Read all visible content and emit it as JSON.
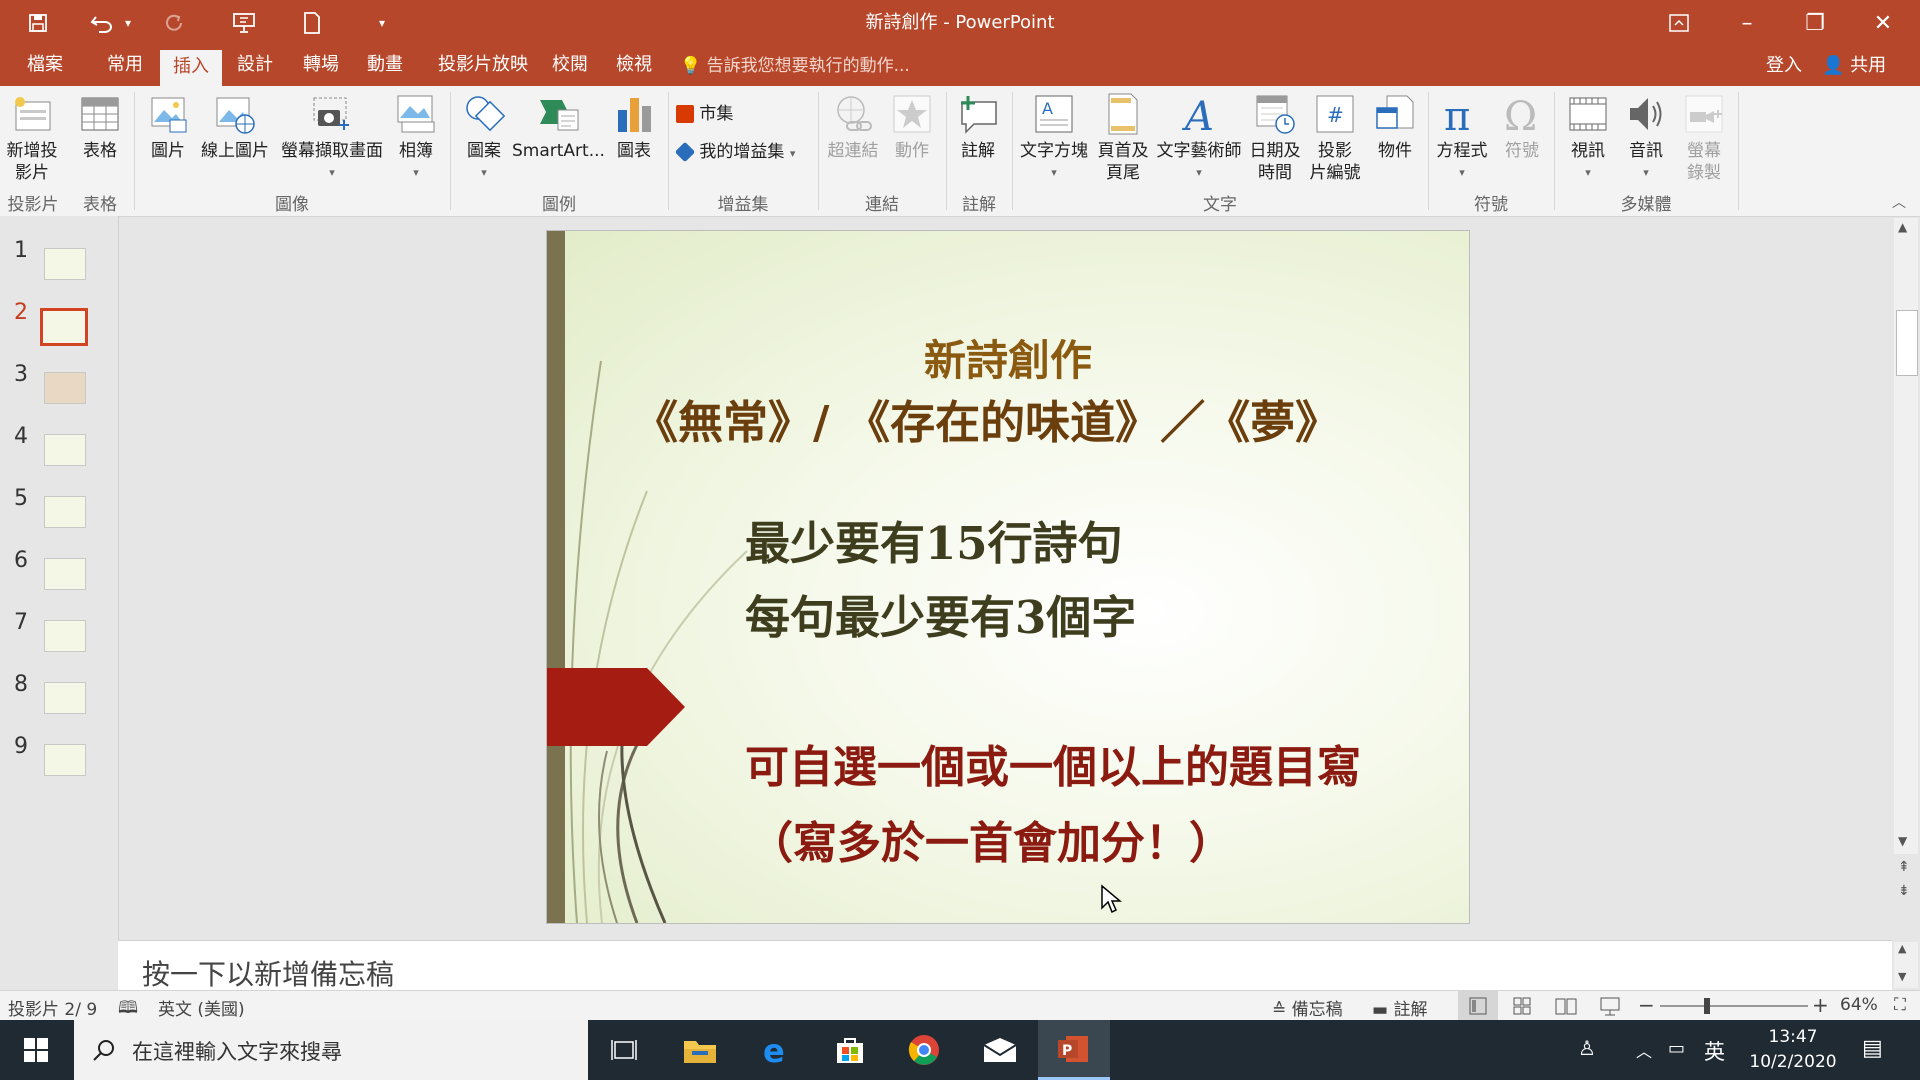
{
  "window": {
    "title": "新詩創作 - PowerPoint",
    "controls": {
      "minimize": "–",
      "restore": "❐",
      "close": "✕"
    }
  },
  "quick_access": {
    "save_icon": "save-icon",
    "undo_icon": "undo-icon",
    "redo_icon": "redo-icon",
    "present_icon": "present-from-start-icon",
    "new_icon": "new-file-icon",
    "customize": "▾"
  },
  "tabs": [
    {
      "label": "檔案"
    },
    {
      "label": "常用"
    },
    {
      "label": "插入"
    },
    {
      "label": "設計"
    },
    {
      "label": "轉場"
    },
    {
      "label": "動畫"
    },
    {
      "label": "投影片放映"
    },
    {
      "label": "校閱"
    },
    {
      "label": "檢視"
    }
  ],
  "active_tab": "插入",
  "tell_me": "告訴我您想要執行的動作...",
  "signin": "登入",
  "share": "共用",
  "ribbon": {
    "new_slide": "新增投\n影片",
    "table": "表格",
    "picture": "圖片",
    "online_picture": "線上圖片",
    "screenshot": "螢幕擷取畫面",
    "album": "相簿",
    "shapes": "圖案",
    "smartart": "SmartArt...",
    "chart": "圖表",
    "store": "市集",
    "my_addins": "我的增益集",
    "hyperlink": "超連結",
    "action": "動作",
    "comment": "註解",
    "textbox": "文字方塊",
    "header_footer": "頁首及\n頁尾",
    "wordart": "文字藝術師",
    "datetime": "日期及\n時間",
    "slide_number": "投影\n片編號",
    "object": "物件",
    "equation": "方程式",
    "symbol": "符號",
    "video": "視訊",
    "audio": "音訊",
    "screen_recording": "螢幕\n錄製",
    "groups": {
      "slides": "投影片",
      "tables": "表格",
      "images": "圖像",
      "illustrations": "圖例",
      "addins": "增益集",
      "links": "連結",
      "comments": "註解",
      "text": "文字",
      "symbols": "符號",
      "media": "多媒體"
    }
  },
  "thumbnails": [
    "1",
    "2",
    "3",
    "4",
    "5",
    "6",
    "7",
    "8",
    "9"
  ],
  "selected_slide": 2,
  "slide": {
    "title_line1": "新詩創作",
    "title_line2": "《無常》/ 《存在的味道》／《夢》",
    "body_line1": "最少要有15行詩句",
    "body_line2": "每句最少要有3個字",
    "note_line1": "可自選一個或一個以上的題目寫",
    "note_line2": "（寫多於一首會加分！）",
    "colors": {
      "title": "#8a5a10",
      "title2": "#6b3e0d",
      "body": "#3e3e1f",
      "note": "#8b1a10",
      "arrow": "#a51c12",
      "bar": "#7b7350"
    }
  },
  "notes_placeholder": "按一下以新增備忘稿",
  "status": {
    "slide_pos": "投影片 2/ 9",
    "language": "英文 (美國)",
    "notes_btn": "備忘稿",
    "comments_btn": "註解",
    "zoom": "64%",
    "zoom_fraction": 0.64
  },
  "taskbar": {
    "search_placeholder": "在這裡輸入文字來搜尋",
    "ime": "英",
    "time": "13:47",
    "date": "10/2/2020",
    "apps": [
      "task-view-icon",
      "file-explorer-icon",
      "edge-icon",
      "store-icon",
      "chrome-icon",
      "mail-icon",
      "powerpoint-icon"
    ]
  }
}
